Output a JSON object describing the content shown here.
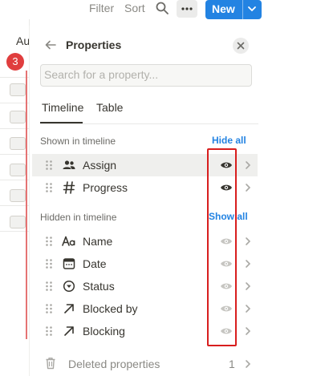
{
  "toolbar": {
    "filter": "Filter",
    "sort": "Sort",
    "new": "New"
  },
  "background": {
    "column_label": "Au",
    "badge_count": "3"
  },
  "panel": {
    "title": "Properties",
    "search_placeholder": "Search for a property...",
    "tabs": [
      {
        "label": "Timeline",
        "active": true
      },
      {
        "label": "Table",
        "active": false
      }
    ],
    "shown_section": {
      "label": "Shown in timeline",
      "action": "Hide all",
      "properties": [
        {
          "name": "Assign",
          "icon": "people-icon",
          "visible": true
        },
        {
          "name": "Progress",
          "icon": "number-icon",
          "visible": true
        }
      ]
    },
    "hidden_section": {
      "label": "Hidden in timeline",
      "action": "Show all",
      "properties": [
        {
          "name": "Name",
          "icon": "text-icon",
          "visible": false
        },
        {
          "name": "Date",
          "icon": "calendar-icon",
          "visible": false
        },
        {
          "name": "Status",
          "icon": "status-icon",
          "visible": false
        },
        {
          "name": "Blocked by",
          "icon": "relation-arrow-icon",
          "visible": false
        },
        {
          "name": "Blocking",
          "icon": "relation-arrow-icon",
          "visible": false
        }
      ]
    },
    "deleted": {
      "label": "Deleted properties",
      "count": "1"
    }
  },
  "colors": {
    "accent": "#2383e2",
    "annotation": "#d81e1e",
    "badge": "#e03e3e"
  }
}
